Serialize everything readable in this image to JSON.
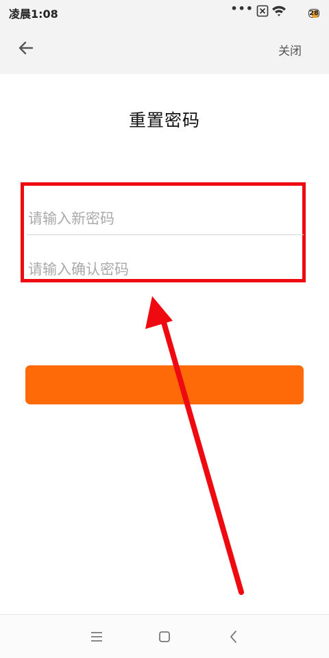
{
  "status_bar": {
    "time": "凌晨1:08",
    "battery": "28",
    "icons": [
      "more-dots-icon",
      "no-sim-icon",
      "wifi-icon",
      "battery-icon"
    ]
  },
  "header": {
    "back_icon": "back-arrow-icon",
    "close_label": "关闭"
  },
  "title": "重置密码",
  "form": {
    "new_password_placeholder": "请输入新密码",
    "confirm_password_placeholder": "请输入确认密码",
    "highlight_color": "#ee0a10"
  },
  "submit_button": {
    "label": "",
    "color": "#ff6a08"
  },
  "annotation": {
    "type": "arrow",
    "color": "#ee0a10"
  },
  "nav_bar": {
    "icons": [
      "menu-icon",
      "home-icon",
      "back-icon"
    ]
  }
}
